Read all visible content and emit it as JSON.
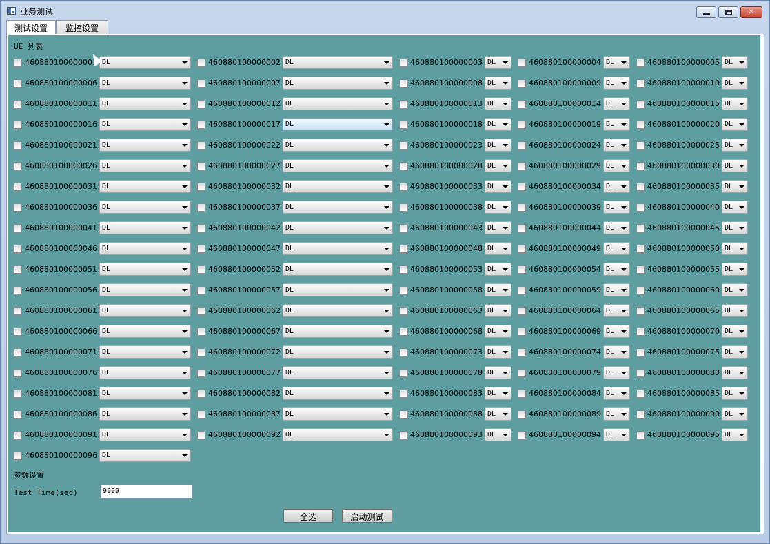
{
  "window": {
    "title": "业务测试"
  },
  "tabs": [
    {
      "label": "测试设置",
      "active": true
    },
    {
      "label": "监控设置",
      "active": false
    }
  ],
  "ue_section_label": "UE 列表",
  "combo_value": "DL",
  "ue_ids": [
    "460880100000001",
    "460880100000002",
    "460880100000003",
    "460880100000004",
    "460880100000005",
    "460880100000006",
    "460880100000007",
    "460880100000008",
    "460880100000009",
    "460880100000010",
    "460880100000011",
    "460880100000012",
    "460880100000013",
    "460880100000014",
    "460880100000015",
    "460880100000016",
    "460880100000017",
    "460880100000018",
    "460880100000019",
    "460880100000020",
    "460880100000021",
    "460880100000022",
    "460880100000023",
    "460880100000024",
    "460880100000025",
    "460880100000026",
    "460880100000027",
    "460880100000028",
    "460880100000029",
    "460880100000030",
    "460880100000031",
    "460880100000032",
    "460880100000033",
    "460880100000034",
    "460880100000035",
    "460880100000036",
    "460880100000037",
    "460880100000038",
    "460880100000039",
    "460880100000040",
    "460880100000041",
    "460880100000042",
    "460880100000043",
    "460880100000044",
    "460880100000045",
    "460880100000046",
    "460880100000047",
    "460880100000048",
    "460880100000049",
    "460880100000050",
    "460880100000051",
    "460880100000052",
    "460880100000053",
    "460880100000054",
    "460880100000055",
    "460880100000056",
    "460880100000057",
    "460880100000058",
    "460880100000059",
    "460880100000060",
    "460880100000061",
    "460880100000062",
    "460880100000063",
    "460880100000064",
    "460880100000065",
    "460880100000066",
    "460880100000067",
    "460880100000068",
    "460880100000069",
    "460880100000070",
    "460880100000071",
    "460880100000072",
    "460880100000073",
    "460880100000074",
    "460880100000075",
    "460880100000076",
    "460880100000077",
    "460880100000078",
    "460880100000079",
    "460880100000080",
    "460880100000081",
    "460880100000082",
    "460880100000083",
    "460880100000084",
    "460880100000085",
    "460880100000086",
    "460880100000087",
    "460880100000088",
    "460880100000089",
    "460880100000090",
    "460880100000091",
    "460880100000092",
    "460880100000093",
    "460880100000094",
    "460880100000095",
    "460880100000096"
  ],
  "params_section_label": "参数设置",
  "test_time": {
    "label": "Test Time(sec)",
    "value": "9999"
  },
  "buttons": {
    "select_all": "全选",
    "start_test": "启动测试"
  },
  "colors": {
    "panel_bg": "#5f9ea0",
    "window_frame": "#c6d7ec"
  },
  "icons": [
    "app-icon",
    "minimize-icon",
    "maximize-icon",
    "close-icon",
    "chevron-down-icon"
  ]
}
